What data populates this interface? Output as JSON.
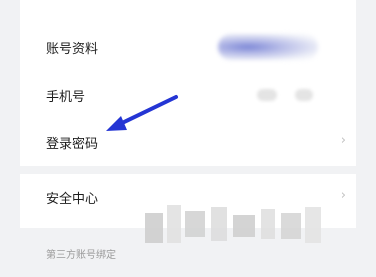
{
  "account": {
    "rows": [
      {
        "label": "账号资料"
      },
      {
        "label": "手机号"
      },
      {
        "label": "登录密码"
      },
      {
        "label": "安全中心"
      }
    ],
    "third_party_title": "第三方账号绑定"
  },
  "annotation": {
    "color": "#2435d4",
    "icon": "arrow-icon"
  },
  "colors": {
    "background": "#f1f2f4",
    "card": "#ffffff",
    "text": "#1e1e1e",
    "muted": "#9a9a9a",
    "chevron": "#c2c2c2"
  }
}
